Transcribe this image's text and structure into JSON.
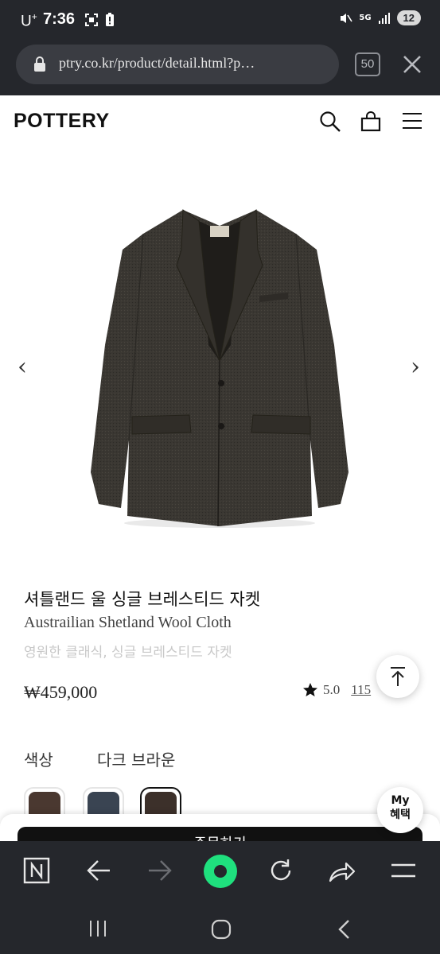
{
  "status_bar": {
    "carrier": "U",
    "carrier_sup": "+",
    "time": "7:36",
    "network": "5G",
    "badge": "12"
  },
  "browser": {
    "url": "ptry.co.kr/product/detail.html?p…",
    "tab_count": "50"
  },
  "site": {
    "logo": "POTTERY"
  },
  "product": {
    "name_ko": "셔틀랜드 울 싱글 브레스티드 자켓",
    "name_en": "Austrailian Shetland Wool Cloth",
    "description": "영원한 클래식, 싱글 브레스티드 자켓",
    "price": "₩459,000",
    "rating": "5.0",
    "review_count": "115",
    "prev_arrow": "‹",
    "next_arrow": "›",
    "image_subject": "jacket"
  },
  "color_option": {
    "label": "색상",
    "selected": "다크 브라운",
    "swatches": [
      {
        "name": "brown",
        "color": "#4a3830"
      },
      {
        "name": "navy",
        "color": "#3a4452"
      },
      {
        "name": "dark-brown",
        "color": "#3c302a"
      }
    ]
  },
  "floating": {
    "my_benefit_line1": "My",
    "my_benefit_line2": "혜택"
  },
  "buy_button": "주문하기",
  "accent_colors": {
    "browser_chrome": "#25272c",
    "home_button": "#1fe07e"
  },
  "icons": [
    "lock-icon",
    "close-icon",
    "search-icon",
    "cart-icon",
    "menu-icon",
    "star-icon",
    "arrow-up-icon",
    "n-icon",
    "back-icon",
    "forward-icon",
    "refresh-icon",
    "share-icon",
    "hamburger-icon",
    "recents-icon",
    "home-circle-icon",
    "nav-back-icon"
  ]
}
